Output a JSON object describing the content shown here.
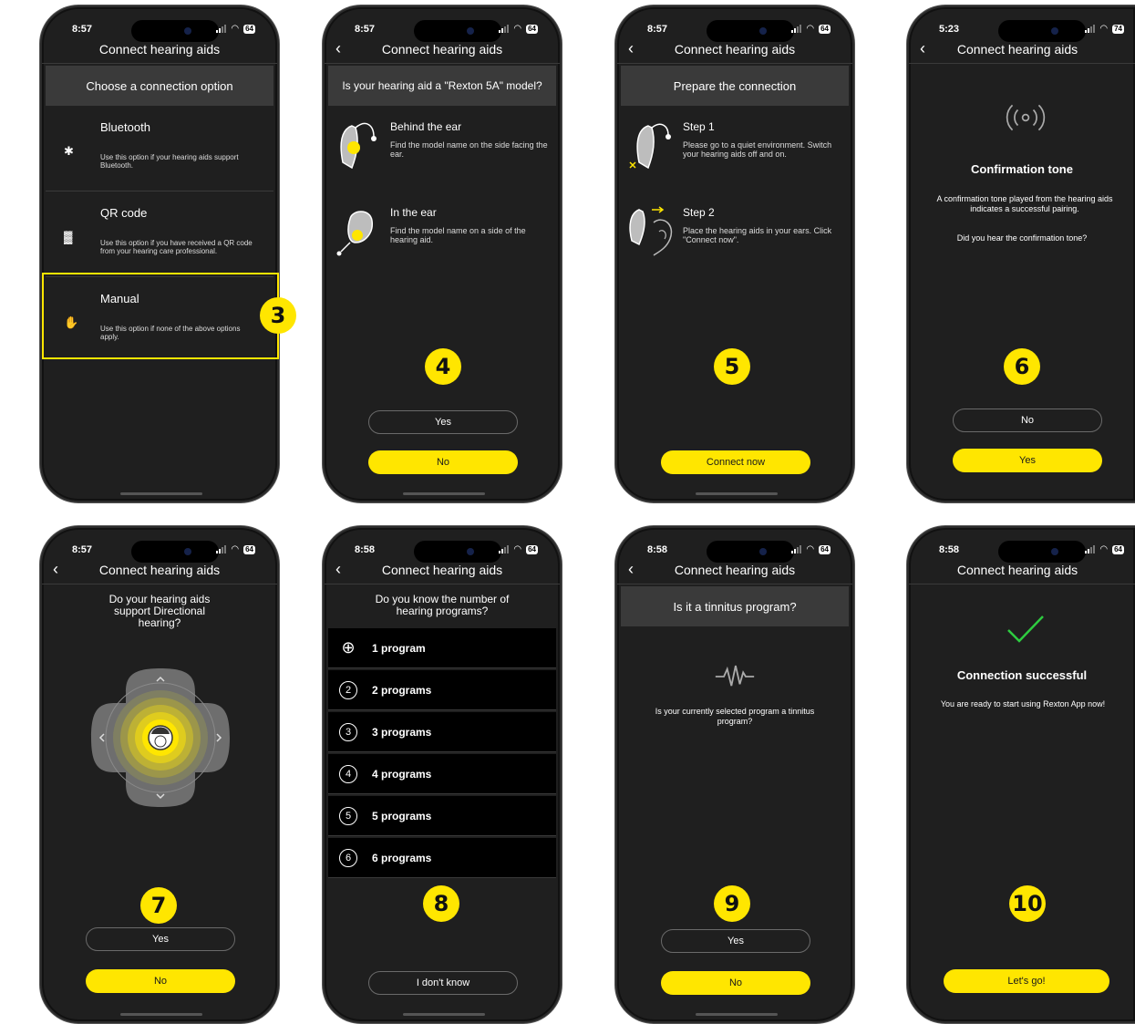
{
  "status_icons": {
    "wifi": "wifi-icon",
    "signal": "signal-icon",
    "battery": "battery-icon"
  },
  "colors": {
    "accent": "#ffe600",
    "background": "#1f1f1f",
    "band": "#3a3a3a",
    "success": "#2ecc40"
  },
  "screens": {
    "s1": {
      "time": "8:57",
      "battery": "64",
      "title": "Connect hearing aids",
      "heading": "Choose a connection option",
      "options": [
        {
          "title": "Bluetooth",
          "desc": "Use this option if your hearing aids support Bluetooth.",
          "icon": "bluetooth-icon"
        },
        {
          "title": "QR code",
          "desc": "Use this option if you have received a QR code from your hearing care professional.",
          "icon": "qr-code-icon"
        },
        {
          "title": "Manual",
          "desc": "Use this option if none of the above options apply.",
          "icon": "hand-icon"
        }
      ],
      "badge": "3"
    },
    "s2": {
      "time": "8:57",
      "battery": "64",
      "title": "Connect hearing aids",
      "heading": "Is your hearing aid a \"Rexton 5A\" model?",
      "types": [
        {
          "title": "Behind the ear",
          "desc": "Find the model name on the side facing the ear.",
          "icon": "behind-the-ear-icon"
        },
        {
          "title": "In the ear",
          "desc": "Find the model name on a side of the hearing aid.",
          "icon": "in-the-ear-icon"
        }
      ],
      "badge": "4",
      "yes": "Yes",
      "no": "No"
    },
    "s3": {
      "time": "8:57",
      "battery": "64",
      "title": "Connect hearing aids",
      "heading": "Prepare the connection",
      "steps": [
        {
          "title": "Step 1",
          "desc": "Please go to a quiet environment. Switch your hearing aids off and on.",
          "icon": "hearing-aid-restart-icon"
        },
        {
          "title": "Step 2",
          "desc": "Place the hearing aids in your ears. Click \"Connect now\".",
          "icon": "hearing-aid-insert-icon"
        }
      ],
      "badge": "5",
      "connect": "Connect now"
    },
    "s4": {
      "time": "5:23",
      "battery": "74",
      "title": "Connect hearing aids",
      "heading": "Confirmation tone",
      "desc": "A confirmation tone played from the hearing aids indicates a successful pairing.",
      "question": "Did you hear the confirmation tone?",
      "icon": "broadcast-icon",
      "badge": "6",
      "no": "No",
      "yes": "Yes"
    },
    "s5": {
      "time": "8:57",
      "battery": "64",
      "title": "Connect hearing aids",
      "heading": "Do your hearing aids support Directional hearing?",
      "icon": "directional-hearing-icon",
      "badge": "7",
      "yes": "Yes",
      "no": "No"
    },
    "s6": {
      "time": "8:58",
      "battery": "64",
      "title": "Connect hearing aids",
      "heading": "Do you know the number of hearing programs?",
      "programs": [
        {
          "label": "1 program",
          "mark": "⊕"
        },
        {
          "label": "2 programs",
          "mark": "2"
        },
        {
          "label": "3 programs",
          "mark": "3"
        },
        {
          "label": "4 programs",
          "mark": "4"
        },
        {
          "label": "5 programs",
          "mark": "5"
        },
        {
          "label": "6 programs",
          "mark": "6"
        }
      ],
      "badge": "8",
      "dont_know": "I don't know"
    },
    "s7": {
      "time": "8:58",
      "battery": "64",
      "title": "Connect hearing aids",
      "heading": "Is it a tinnitus program?",
      "desc": "Is your currently selected program a tinnitus program?",
      "icon": "sound-wave-icon",
      "badge": "9",
      "yes": "Yes",
      "no": "No"
    },
    "s8": {
      "time": "8:58",
      "battery": "64",
      "title": "Connect hearing aids",
      "heading": "Connection successful",
      "desc": "You are ready to start using Rexton App now!",
      "icon": "checkmark-icon",
      "badge": "10",
      "go": "Let's go!"
    }
  }
}
